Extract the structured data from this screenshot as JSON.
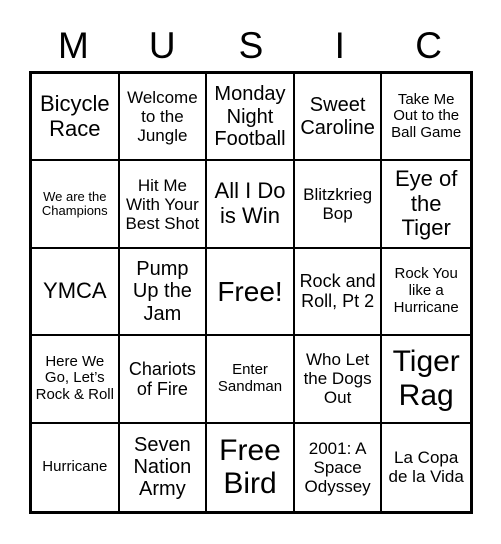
{
  "title_letters": [
    "M",
    "U",
    "S",
    "I",
    "C"
  ],
  "cells": [
    {
      "text": "Bicycle Race",
      "size": "s22"
    },
    {
      "text": "Welcome to the Jungle",
      "size": "s17"
    },
    {
      "text": "Monday Night Football",
      "size": "s20"
    },
    {
      "text": "Sweet Caroline",
      "size": "s20"
    },
    {
      "text": "Take Me Out to the Ball Game",
      "size": "s15"
    },
    {
      "text": "We are the Champions",
      "size": "s13"
    },
    {
      "text": "Hit Me With Your Best Shot",
      "size": "s17"
    },
    {
      "text": "All I Do is Win",
      "size": "s22"
    },
    {
      "text": "Blitzkrieg Bop",
      "size": "s17"
    },
    {
      "text": "Eye of the Tiger",
      "size": "s22"
    },
    {
      "text": "YMCA",
      "size": "s22"
    },
    {
      "text": "Pump Up the Jam",
      "size": "s20"
    },
    {
      "text": "Free!",
      "size": "s28"
    },
    {
      "text": "Rock and Roll, Pt 2",
      "size": "s18"
    },
    {
      "text": "Rock You like a Hurricane",
      "size": "s15"
    },
    {
      "text": "Here We Go, Let’s Rock & Roll",
      "size": "s15"
    },
    {
      "text": "Chariots of Fire",
      "size": "s18"
    },
    {
      "text": "Enter Sandman",
      "size": "s15"
    },
    {
      "text": "Who Let the Dogs Out",
      "size": "s17"
    },
    {
      "text": "Tiger Rag",
      "size": "s30"
    },
    {
      "text": "Hurricane",
      "size": "s15"
    },
    {
      "text": "Seven Nation Army",
      "size": "s20"
    },
    {
      "text": "Free Bird",
      "size": "s30"
    },
    {
      "text": "2001: A Space Odyssey",
      "size": "s17"
    },
    {
      "text": "La Copa de la Vida",
      "size": "s17"
    }
  ]
}
